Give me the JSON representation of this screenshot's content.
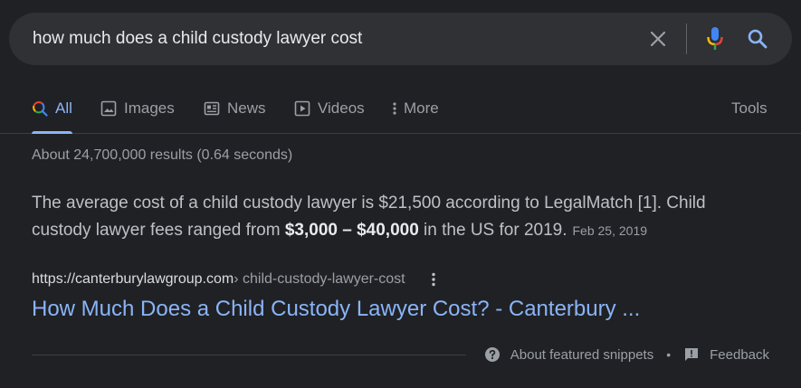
{
  "search": {
    "query": "how much does a child custody lawyer cost"
  },
  "tabs": [
    {
      "label": "All",
      "icon": "search-icon",
      "active": true
    },
    {
      "label": "Images",
      "icon": "image-icon"
    },
    {
      "label": "News",
      "icon": "news-icon"
    },
    {
      "label": "Videos",
      "icon": "play-icon"
    },
    {
      "label": "More",
      "icon": "more-vert-icon"
    }
  ],
  "tools_label": "Tools",
  "stats": "About 24,700,000 results (0.64 seconds)",
  "snippet": {
    "text_1": "The average cost of a child custody lawyer is $21,500 according to LegalMatch [1]. Child custody lawyer fees ranged from ",
    "bold": "$3,000 – $40,000",
    "text_2": " in the US for 2019.",
    "date": "Feb 25, 2019"
  },
  "result": {
    "domain": "https://canterburylawgroup.com",
    "path": " › child-custody-lawyer-cost",
    "title": "How Much Does a Child Custody Lawyer Cost? - Canterbury ..."
  },
  "footer": {
    "about_label": "About featured snippets",
    "separator": "•",
    "feedback_label": "Feedback"
  },
  "colors": {
    "background": "#202124",
    "searchbar": "#303134",
    "link": "#8ab4f8",
    "text": "#bdc1c6",
    "muted": "#9aa0a6"
  }
}
